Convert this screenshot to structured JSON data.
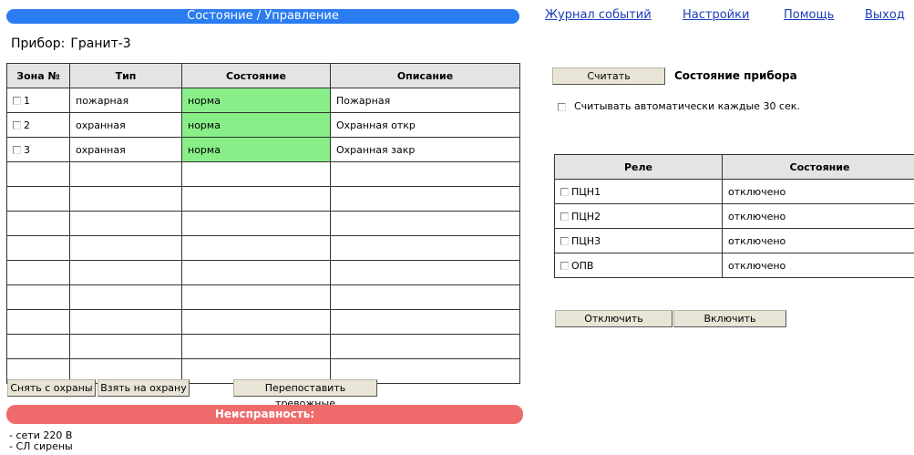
{
  "header": {
    "title": "Состояние / Управление",
    "nav": [
      "Журнал событий",
      "Настройки",
      "Помощь",
      "Выход"
    ],
    "title_bg": "#2a7cf0"
  },
  "device": {
    "label": "Прибор:",
    "name": "Гранит-3"
  },
  "zones": {
    "headers": [
      "Зона №",
      "Тип",
      "Состояние",
      "Описание"
    ],
    "rows": [
      {
        "num": "1",
        "type": "пожарная",
        "state": "норма",
        "desc": "Пожарная"
      },
      {
        "num": "2",
        "type": "охранная",
        "state": "норма",
        "desc": "Охранная откр"
      },
      {
        "num": "3",
        "type": "охранная",
        "state": "норма",
        "desc": "Охранная закр"
      }
    ],
    "empty_rows": 9,
    "state_ok_color": "#88ef88"
  },
  "zone_actions": {
    "disarm": "Снять с охраны",
    "arm": "Взять на охрану",
    "reset_alarms": "Перепоставить тревожные"
  },
  "device_panel": {
    "read_button": "Считать",
    "state_title": "Состояние прибора",
    "auto_read_label": "Считывать автоматически каждые 30 сек."
  },
  "relays": {
    "headers": [
      "Реле",
      "Состояние"
    ],
    "rows": [
      {
        "name": "ПЦН1",
        "state": "отключено"
      },
      {
        "name": "ПЦН2",
        "state": "отключено"
      },
      {
        "name": "ПЦН3",
        "state": "отключено"
      },
      {
        "name": "ОПВ",
        "state": "отключено"
      }
    ]
  },
  "relay_actions": {
    "off": "Отключить",
    "on": "Включить"
  },
  "faults": {
    "title": "Неисправность:",
    "items": [
      "- сети 220 В",
      "- СЛ сирены"
    ],
    "bar_color": "#ef6b6b"
  }
}
